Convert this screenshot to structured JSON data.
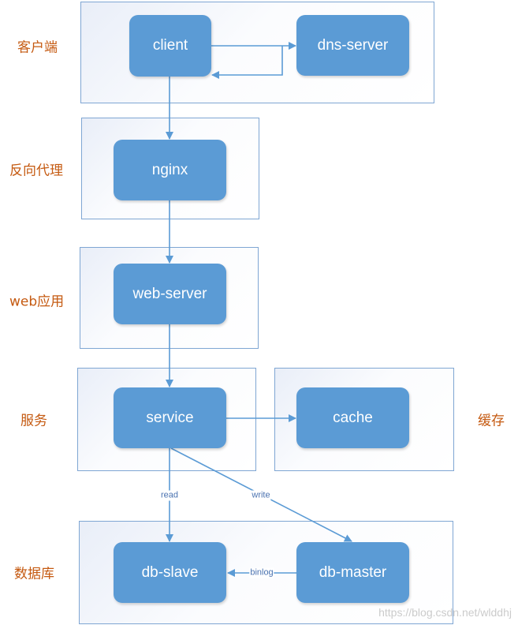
{
  "layers": [
    {
      "label": "客户端",
      "nodes": [
        "client",
        "dns-server"
      ]
    },
    {
      "label": "反向代理",
      "nodes": [
        "nginx"
      ]
    },
    {
      "label": "web应用",
      "nodes": [
        "web-server"
      ]
    },
    {
      "label": "服务",
      "nodes": [
        "service"
      ]
    },
    {
      "label": "缓存",
      "nodes": [
        "cache"
      ]
    },
    {
      "label": "数据库",
      "nodes": [
        "db-slave",
        "db-master"
      ]
    }
  ],
  "edges": {
    "read": "read",
    "write": "write",
    "binlog": "binlog"
  },
  "watermark": "https://blog.csdn.net/wlddhj",
  "colors": {
    "node": "#5b9bd5",
    "line": "#5b9bd5",
    "layer_label": "#c55a11",
    "group_border": "#7fa6d3"
  }
}
